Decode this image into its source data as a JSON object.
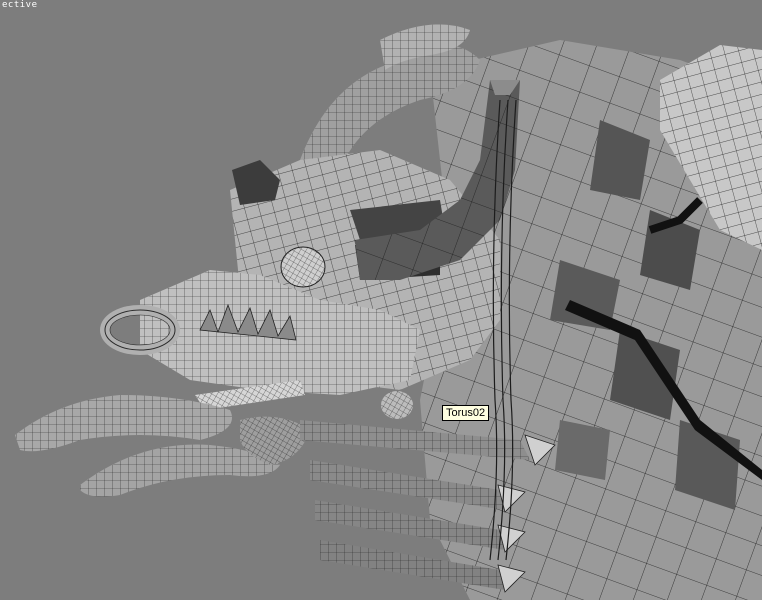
{
  "viewport": {
    "label": "ective",
    "background": "#7d7d7d",
    "wire_color": "#1e1e1e"
  },
  "tooltip": {
    "text": "Torus02",
    "background": "#ffffe1"
  }
}
